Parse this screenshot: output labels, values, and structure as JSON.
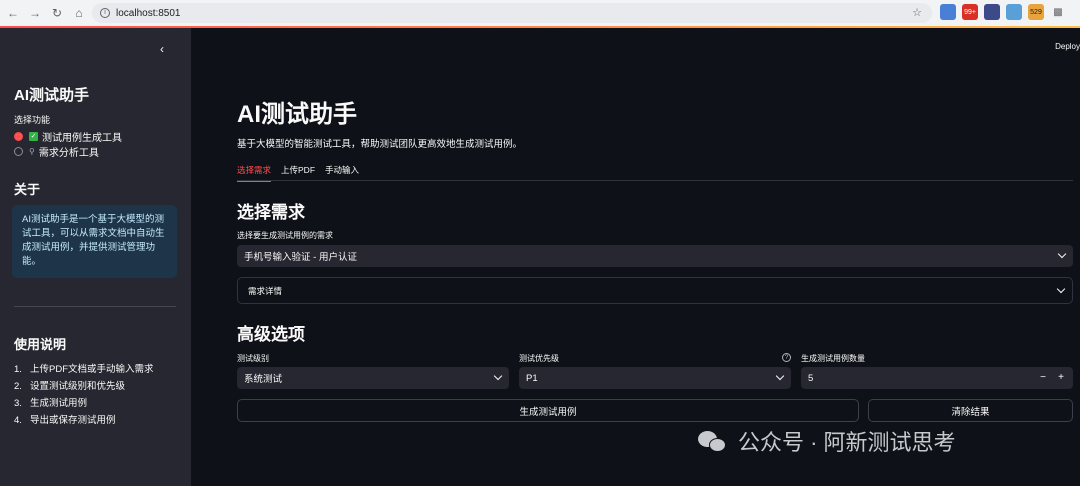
{
  "browser": {
    "url": "localhost:8501",
    "extensions": [
      "ext-1",
      "99+",
      "ext-3",
      "ext-4",
      "529",
      "puzzle"
    ]
  },
  "sidebar": {
    "title": "AI测试助手",
    "function_label": "选择功能",
    "options": [
      {
        "label": "测试用例生成工具",
        "selected": true,
        "icon": "check-box-icon"
      },
      {
        "label": "需求分析工具",
        "selected": false,
        "icon": "magnifier-icon"
      }
    ],
    "about_heading": "关于",
    "about_text": "AI测试助手是一个基于大模型的测试工具，可以从需求文档中自动生成测试用例，并提供测试管理功能。",
    "usage_heading": "使用说明",
    "usage_steps": [
      {
        "num": "1.",
        "text": "上传PDF文档或手动输入需求"
      },
      {
        "num": "2.",
        "text": "设置测试级别和优先级"
      },
      {
        "num": "3.",
        "text": "生成测试用例"
      },
      {
        "num": "4.",
        "text": "导出或保存测试用例"
      }
    ]
  },
  "header": {
    "deploy_label": "Deploy"
  },
  "main": {
    "title": "AI测试助手",
    "description": "基于大模型的智能测试工具，帮助测试团队更高效地生成测试用例。",
    "tabs": [
      {
        "label": "选择需求",
        "active": true
      },
      {
        "label": "上传PDF",
        "active": false
      },
      {
        "label": "手动输入",
        "active": false
      }
    ],
    "select_section_title": "选择需求",
    "requirement_label": "选择要生成测试用例的需求",
    "requirement_value": "手机号输入验证 - 用户认证",
    "expander_label": "需求详情",
    "advanced_title": "高级选项",
    "level_label": "测试级别",
    "level_value": "系统测试",
    "priority_label": "测试优先级",
    "priority_value": "P1",
    "count_label": "生成测试用例数量",
    "count_value": "5",
    "generate_button": "生成测试用例",
    "clear_button": "清除结果"
  },
  "watermark": {
    "text": "公众号 · 阿新测试思考"
  },
  "colors": {
    "primary": "#ff4b4b",
    "background": "#0e1117",
    "sidebar": "#262730",
    "info_box": "#1d3449"
  }
}
